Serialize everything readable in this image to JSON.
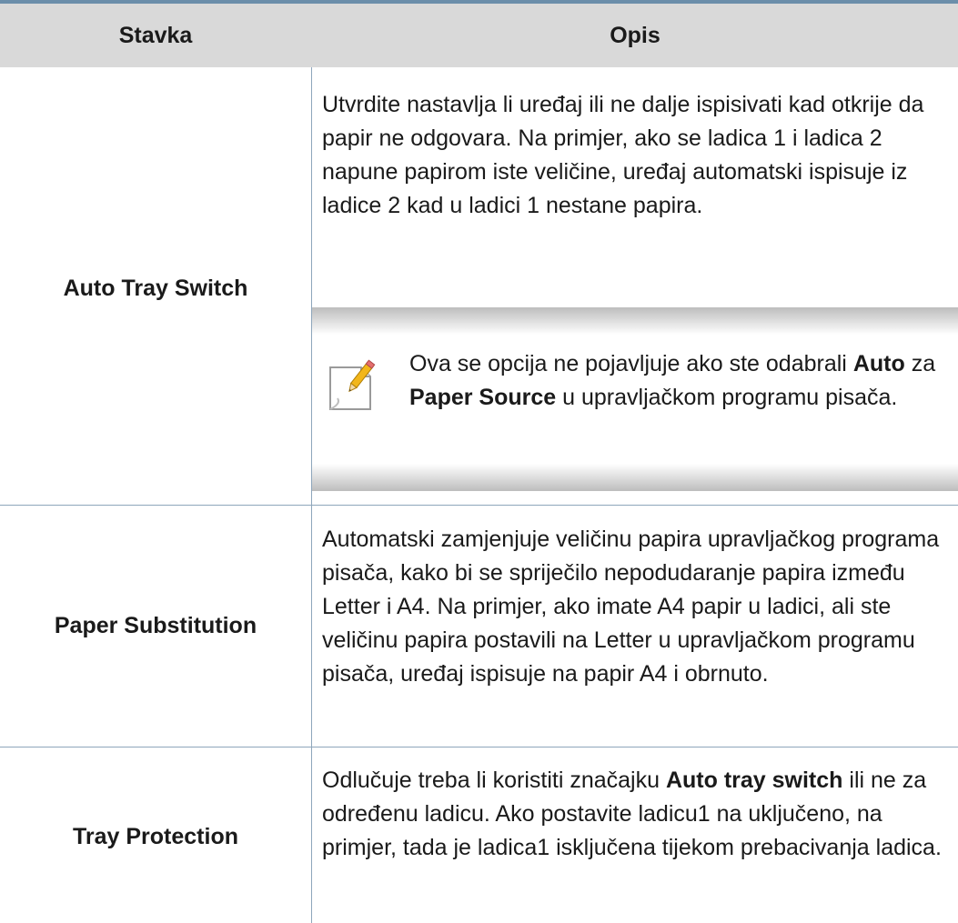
{
  "table": {
    "headers": {
      "item": "Stavka",
      "description": "Opis"
    },
    "rows": [
      {
        "item": "Auto Tray Switch",
        "description": "Utvrdite nastavlja li uređaj ili ne dalje ispisivati kad otkrije da papir ne odgovara. Na primjer, ako se ladica 1 i ladica 2 napune papirom iste veličine, uređaj automatski ispisuje iz ladice 2 kad u ladici 1 nestane papira.",
        "note": {
          "icon": "note-pencil-icon",
          "part1": "Ova se opcija ne pojavljuje ako ste odabrali",
          "bold1": "Auto",
          "part2": "za",
          "bold2": "Paper Source",
          "part3": "u upravljačkom programu pisača."
        }
      },
      {
        "item": "Paper Substitution",
        "description": "Automatski zamjenjuje veličinu papira upravljačkog programa pisača, kako bi se spriječilo nepodudaranje papira između Letter i A4. Na primjer, ako imate A4 papir u ladici, ali ste veličinu papira postavili na Letter u upravljačkom programu pisača, uređaj ispisuje na papir A4 i obrnuto."
      },
      {
        "item": "Tray Protection",
        "desc_part1": "Odlučuje treba li koristiti značajku",
        "desc_bold": "Auto tray switch",
        "desc_part2": "ili ne za određenu ladicu. Ako postavite ladicu1 na uključeno, na primjer, tada je ladica1 isključena tijekom prebacivanja ladica."
      }
    ]
  },
  "colors": {
    "rule": "#6b8eaa",
    "header_bg": "#d9d9d9",
    "grid": "#8ea6bb"
  }
}
